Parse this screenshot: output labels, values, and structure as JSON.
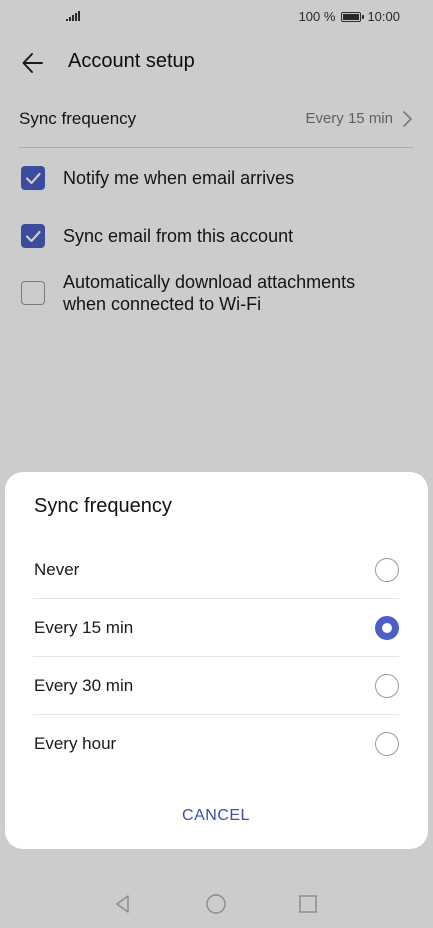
{
  "status_bar": {
    "battery_percent": "100 %",
    "time": "10:00",
    "battery_icon": "battery-icon",
    "signal_icon": "signal-icon"
  },
  "header": {
    "title": "Account setup",
    "back_icon": "arrow-left-icon"
  },
  "sync_frequency_row": {
    "label": "Sync frequency",
    "value": "Every 15 min",
    "chevron_icon": "chevron-right-icon"
  },
  "checkboxes": [
    {
      "label": "Notify me when email arrives",
      "checked": true
    },
    {
      "label": "Sync email from this account",
      "checked": true
    },
    {
      "label_line1": "Automatically download attachments",
      "label_line2": "when connected to Wi-Fi",
      "checked": false
    }
  ],
  "dialog": {
    "title": "Sync frequency",
    "options": [
      {
        "label": "Never",
        "selected": false
      },
      {
        "label": "Every 15 min",
        "selected": true
      },
      {
        "label": "Every 30 min",
        "selected": false
      },
      {
        "label": "Every hour",
        "selected": false
      }
    ],
    "cancel_label": "CANCEL"
  },
  "nav_bar": {
    "back_icon": "triangle-back-icon",
    "home_icon": "circle-home-icon",
    "recents_icon": "square-recents-icon"
  },
  "colors": {
    "accent": "#4a5fc7",
    "cancel_text": "#3b4fa8",
    "scrim": "rgba(0,0,0,0.2)"
  }
}
